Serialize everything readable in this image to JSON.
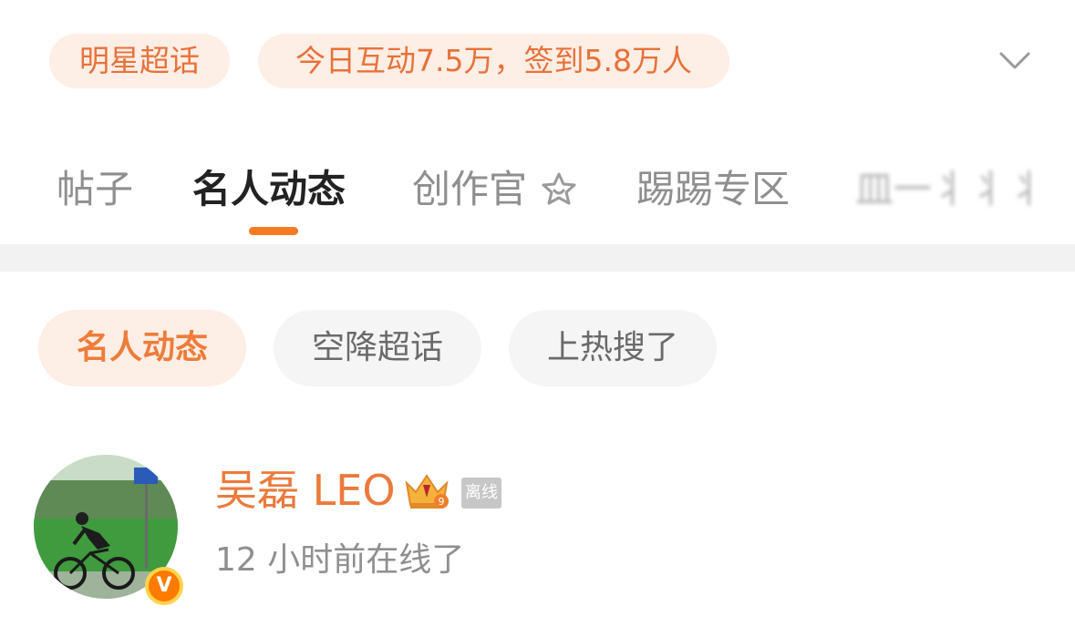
{
  "top_chips": {
    "chip1": "明星超话",
    "chip2": "今日互动7.5万，签到5.8万人"
  },
  "tabs": {
    "items": [
      {
        "label": "帖子"
      },
      {
        "label": "名人动态"
      },
      {
        "label": "创作官"
      },
      {
        "label": "踢踢专区"
      },
      {
        "label": "皿一丬丬丬"
      }
    ],
    "active_index": 1
  },
  "filters": {
    "items": [
      {
        "label": "名人动态"
      },
      {
        "label": "空降超话"
      },
      {
        "label": "上热搜了"
      }
    ]
  },
  "user": {
    "name": "吴磊 LEO",
    "status_badge": "离线",
    "last_seen": "12 小时前在线了",
    "verified_badge": "V"
  },
  "colors": {
    "accent": "#f77a22",
    "chip_bg": "#fdeee6",
    "chip_text": "#e8723a"
  },
  "icons": [
    "chevron-down-icon",
    "star-badge-icon",
    "crown-icon",
    "verified-icon"
  ]
}
